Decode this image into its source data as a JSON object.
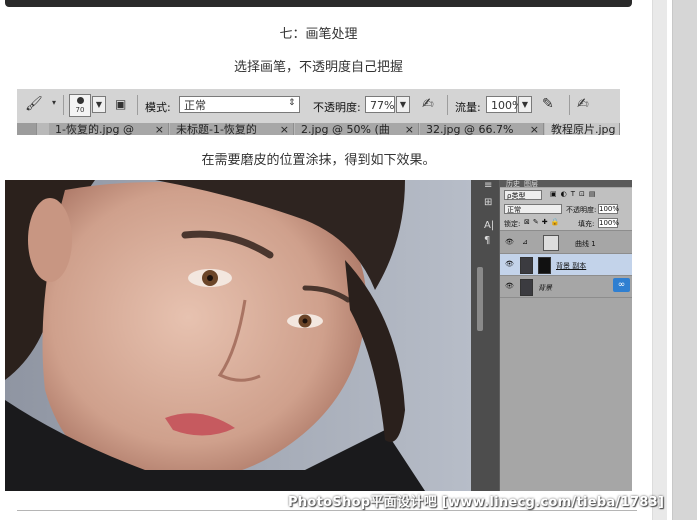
{
  "article": {
    "step_title": "七：画笔处理",
    "step_desc": "选择画笔，不透明度自己把握",
    "result_desc": "在需要磨皮的位置涂抹，得到如下效果。"
  },
  "ps_toolbar": {
    "brush_size": "70",
    "mode_label": "模式:",
    "mode_value": "正常",
    "opacity_label": "不透明度:",
    "opacity_value": "77%",
    "flow_label": "流量:",
    "flow_value": "100%"
  },
  "ps_tabs": [
    {
      "label": "1-恢复的.jpg @"
    },
    {
      "label": "未标题-1-恢复的"
    },
    {
      "label": "2.jpg @ 50% (曲"
    },
    {
      "label": "32.jpg @ 66.7%"
    },
    {
      "label": "教程原片.jpg"
    }
  ],
  "layers_panel": {
    "tab_history": "历史",
    "tab_layers": "图层",
    "filter_kind": "ρ类型",
    "blend_mode": "正常",
    "opacity_label": "不透明度:",
    "opacity_value": "100%",
    "lock_label": "锁定:",
    "fill_label": "填充:",
    "fill_value": "100%",
    "layers": [
      {
        "name": "曲线 1"
      },
      {
        "name": "背景 副本"
      },
      {
        "name": "背景"
      }
    ]
  },
  "watermark": "PhotoShop平面设计吧 [www.linecg.com/tieba/1783]"
}
